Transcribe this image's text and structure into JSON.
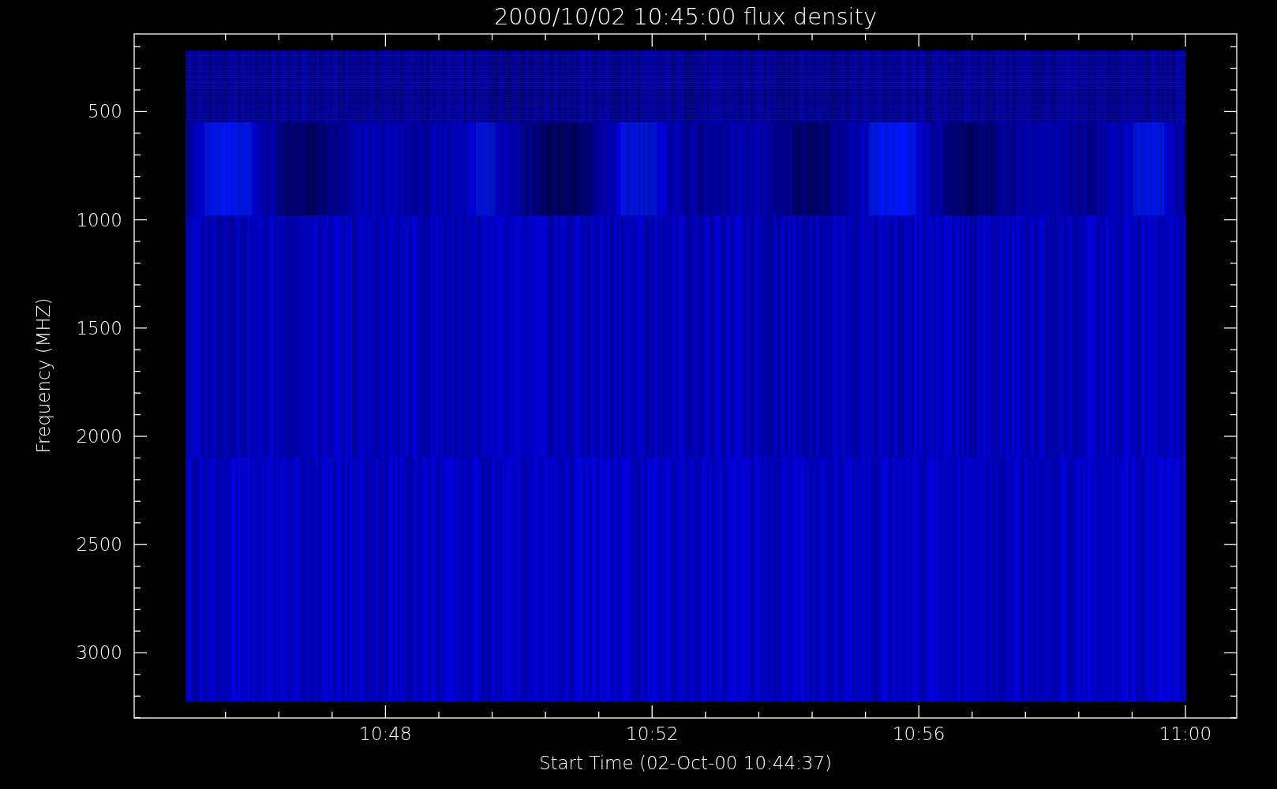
{
  "title": "2000/10/02 10:45:00 flux density",
  "y_axis": {
    "label": "Frequency (MHZ)",
    "ticks": [
      "500",
      "1000",
      "1500",
      "2000",
      "2500",
      "3000"
    ]
  },
  "x_axis": {
    "label": "Start Time (02-Oct-00 10:44:37)",
    "ticks": [
      "10:48",
      "10:52",
      "10:56",
      "11:00"
    ]
  }
}
